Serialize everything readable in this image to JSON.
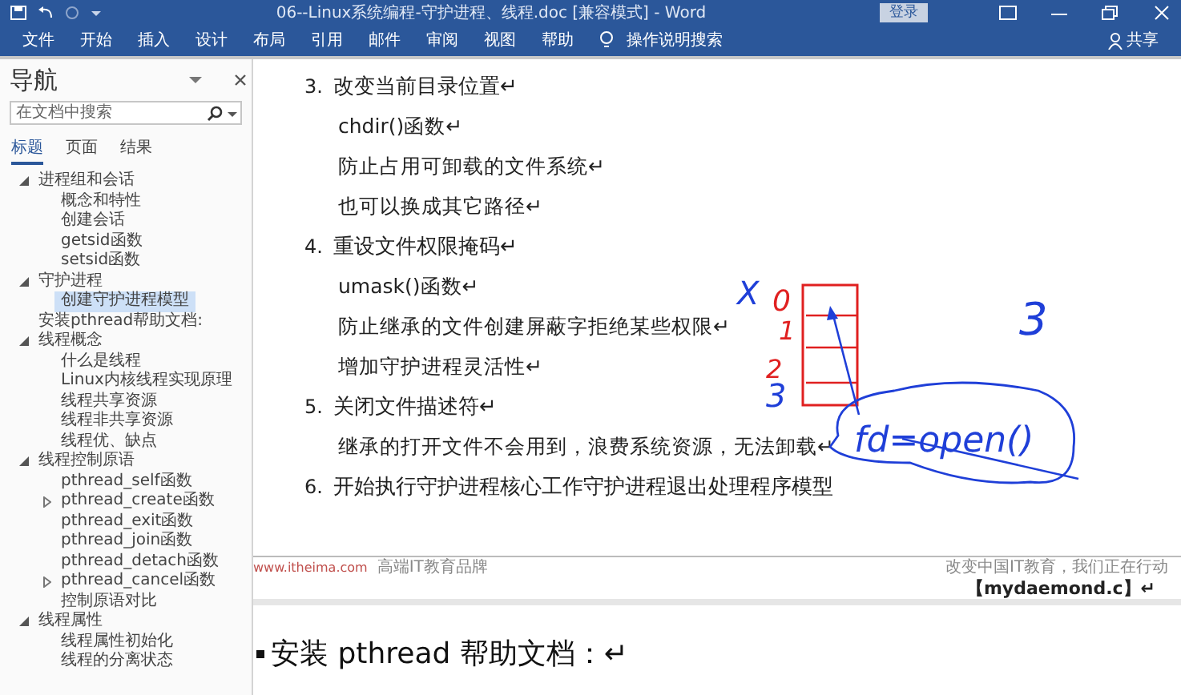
{
  "window": {
    "title": "06--Linux系统编程-守护进程、线程.doc [兼容模式] - Word",
    "login": "登录"
  },
  "ribbon": {
    "tabs": [
      "文件",
      "开始",
      "插入",
      "设计",
      "布局",
      "引用",
      "邮件",
      "审阅",
      "视图",
      "帮助"
    ],
    "tell_me": "操作说明搜索",
    "share": "共享"
  },
  "nav": {
    "title": "导航",
    "search": {
      "placeholder": "在文档中搜索"
    },
    "tabs": [
      {
        "label": "标题",
        "selected": true
      },
      {
        "label": "页面",
        "selected": false
      },
      {
        "label": "结果",
        "selected": false
      }
    ],
    "tree": [
      {
        "label": "进程组和会话",
        "kind": "expanded",
        "selected": false,
        "children": [
          {
            "label": "概念和特性",
            "kind": "leaf",
            "selected": false
          },
          {
            "label": "创建会话",
            "kind": "leaf",
            "selected": false
          },
          {
            "label": "getsid函数",
            "kind": "leaf",
            "selected": false
          },
          {
            "label": "setsid函数",
            "kind": "leaf",
            "selected": false
          }
        ]
      },
      {
        "label": "守护进程",
        "kind": "expanded",
        "selected": false,
        "children": [
          {
            "label": "创建守护进程模型",
            "kind": "leaf",
            "selected": true
          }
        ]
      },
      {
        "label": "安装pthread帮助文档:",
        "kind": "leaf",
        "selected": false
      },
      {
        "label": "线程概念",
        "kind": "expanded",
        "selected": false,
        "children": [
          {
            "label": "什么是线程",
            "kind": "leaf",
            "selected": false
          },
          {
            "label": "Linux内核线程实现原理",
            "kind": "leaf",
            "selected": false
          },
          {
            "label": "线程共享资源",
            "kind": "leaf",
            "selected": false
          },
          {
            "label": "线程非共享资源",
            "kind": "leaf",
            "selected": false
          },
          {
            "label": "线程优、缺点",
            "kind": "leaf",
            "selected": false
          }
        ]
      },
      {
        "label": "线程控制原语",
        "kind": "expanded",
        "selected": false,
        "children": [
          {
            "label": "pthread_self函数",
            "kind": "leaf",
            "selected": false
          },
          {
            "label": "pthread_create函数",
            "kind": "collapsed",
            "selected": false
          },
          {
            "label": "pthread_exit函数",
            "kind": "leaf",
            "selected": false
          },
          {
            "label": "pthread_join函数",
            "kind": "leaf",
            "selected": false
          },
          {
            "label": "pthread_detach函数",
            "kind": "leaf",
            "selected": false
          },
          {
            "label": "pthread_cancel函数",
            "kind": "collapsed",
            "selected": false
          },
          {
            "label": "控制原语对比",
            "kind": "leaf",
            "selected": false
          }
        ]
      },
      {
        "label": "线程属性",
        "kind": "expanded",
        "selected": false,
        "children": [
          {
            "label": "线程属性初始化",
            "kind": "leaf",
            "selected": false
          },
          {
            "label": "线程的分离状态",
            "kind": "leaf",
            "selected": false
          }
        ]
      }
    ]
  },
  "document": {
    "steps": [
      {
        "number": "3.",
        "title": "改变当前目录位置↵",
        "lines": [
          "chdir()函数↵",
          "防止占用可卸载的文件系统↵",
          "也可以换成其它路径↵"
        ]
      },
      {
        "number": "4.",
        "title": "重设文件权限掩码↵",
        "lines": [
          "umask()函数↵",
          "防止继承的文件创建屏蔽字拒绝某些权限↵",
          "增加守护进程灵活性↵"
        ]
      },
      {
        "number": "5.",
        "title": "关闭文件描述符↵",
        "lines": [
          "继承的打开文件不会用到，浪费系统资源，无法卸载↵"
        ]
      },
      {
        "number": "6.",
        "title": "开始执行守护进程核心工作守护进程退出处理程序模型"
      }
    ],
    "footer": {
      "site": "www.itheima.com",
      "tagline": "高端IT教育品牌",
      "slogan": "改变中国IT教育，我们正在行动"
    },
    "file_label": "【mydaemond.c】↵",
    "heading": "安装 pthread 帮助文档：↵"
  },
  "annotations": [
    {
      "text": "X",
      "color": "#1f3fd8"
    },
    {
      "text": "0",
      "color": "#e02020"
    },
    {
      "text": "1",
      "color": "#e02020"
    },
    {
      "text": "2",
      "color": "#e02020"
    },
    {
      "text": "3",
      "color": "#1f3fd8"
    },
    {
      "text": "fd=open()",
      "color": "#1f3fd8"
    },
    {
      "text": "3",
      "color": "#1f3fd8"
    }
  ]
}
